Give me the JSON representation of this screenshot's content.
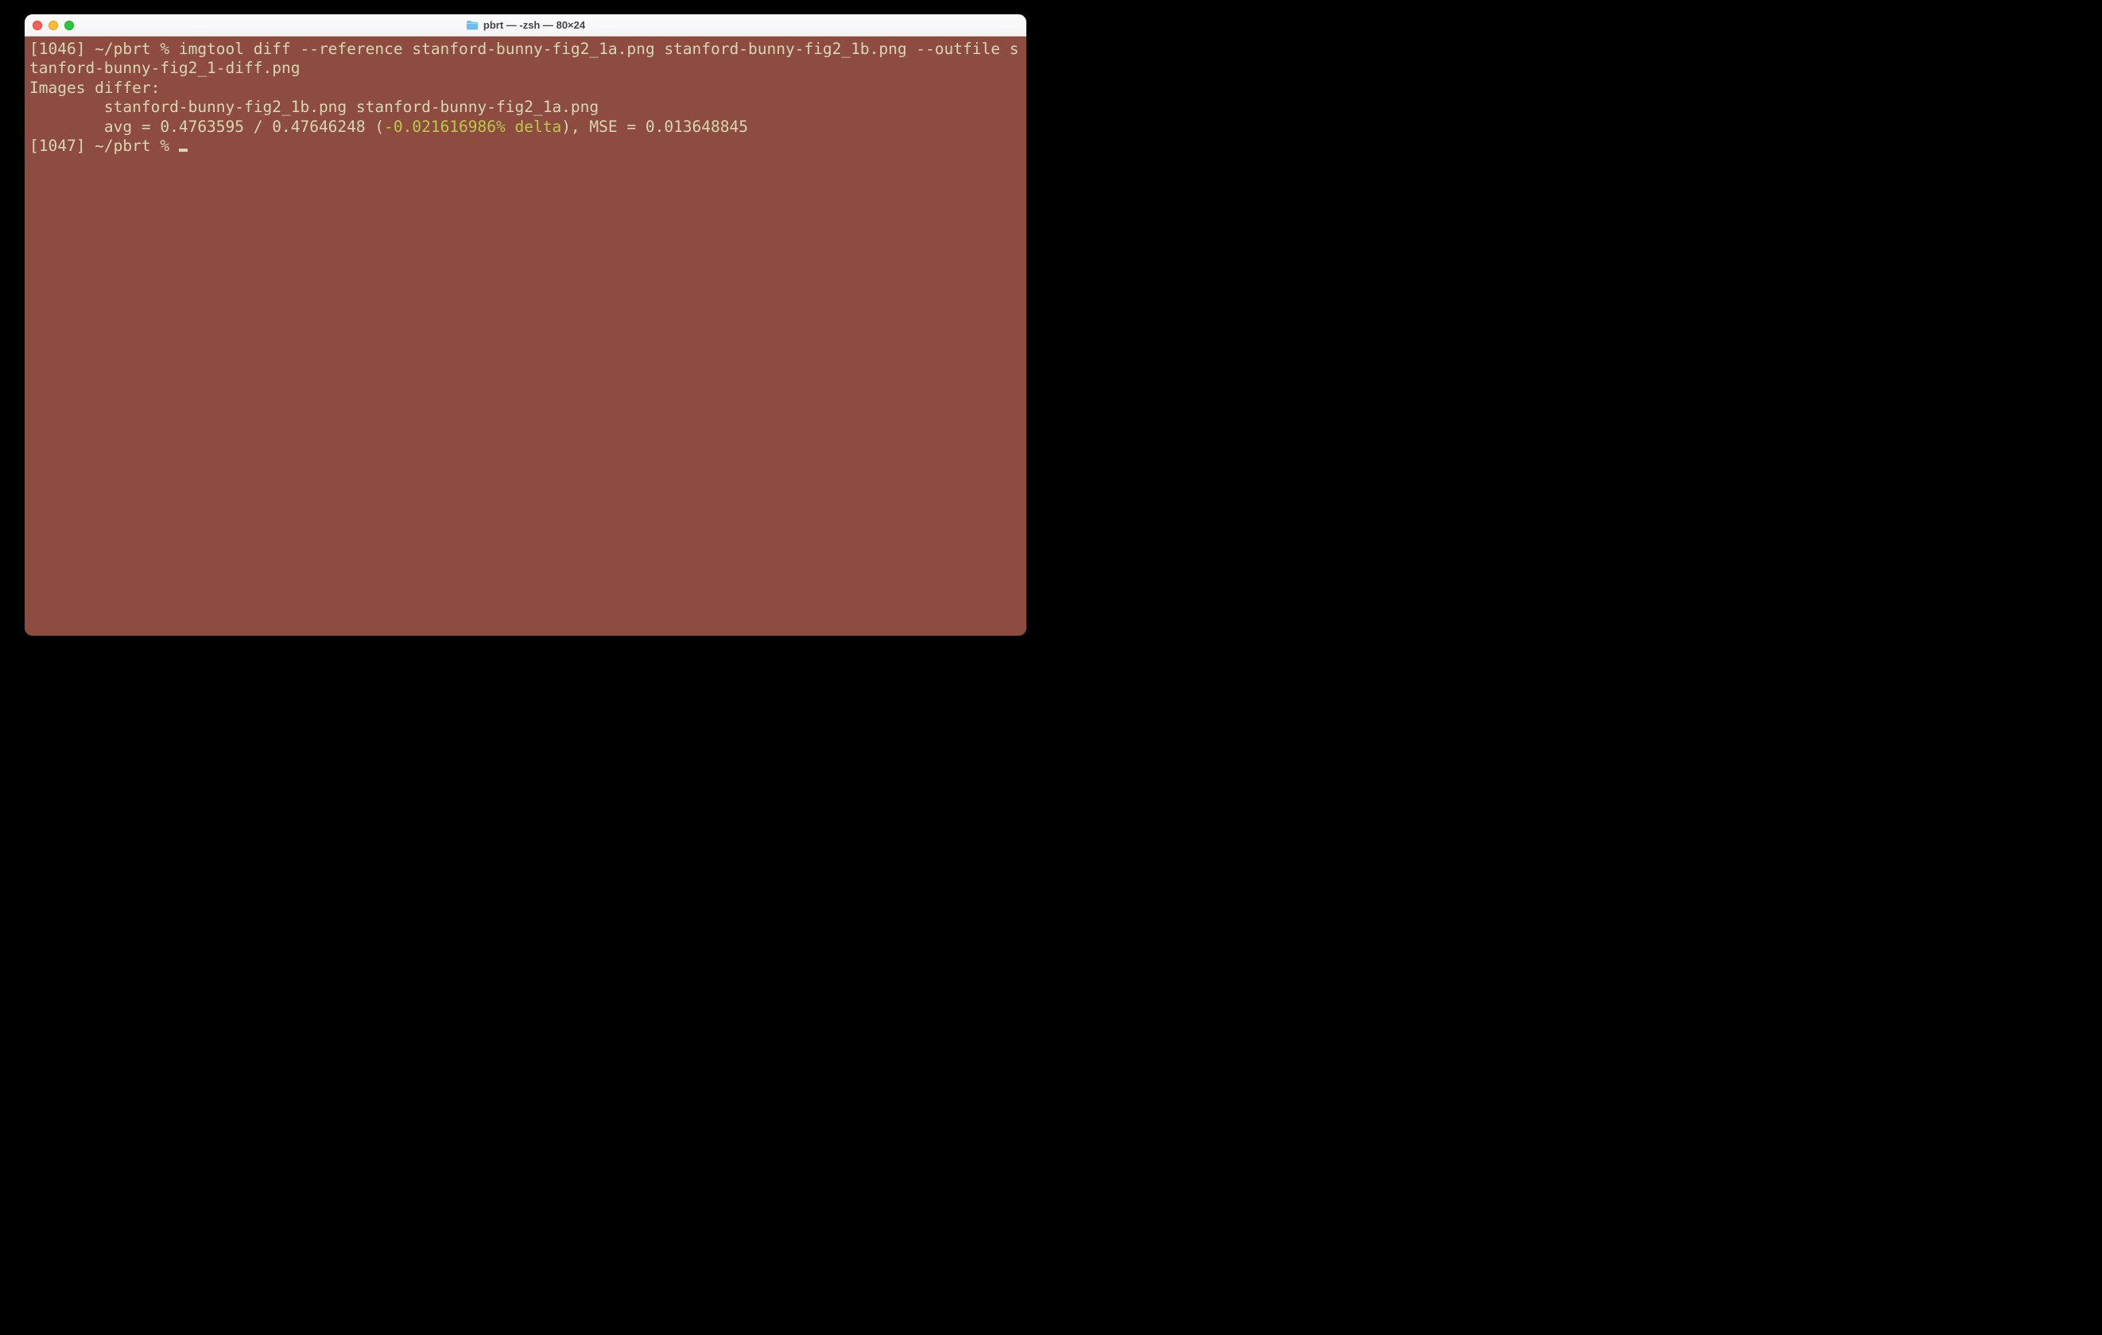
{
  "window": {
    "title": "pbrt — -zsh — 80×24"
  },
  "terminal": {
    "line1": "[1046] ~/pbrt % imgtool diff --reference stanford-bunny-fig2_1a.png stanford-bunny-fig2_1b.png --outfile stanford-bunny-fig2_1-diff.png",
    "line2": "Images differ:",
    "line3": "        stanford-bunny-fig2_1b.png stanford-bunny-fig2_1a.png",
    "line4_a": "        avg = 0.4763595 / 0.47646248 (",
    "line4_hl": "-0.021616986% delta",
    "line4_b": "), MSE = 0.013648845",
    "line5": "[1047] ~/pbrt % "
  }
}
